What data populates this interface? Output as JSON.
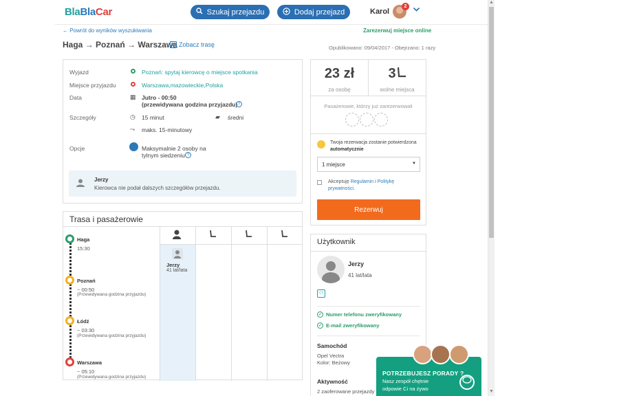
{
  "header": {
    "logo_bla1": "Bla",
    "logo_bla2": "Bla",
    "logo_car": "Car",
    "search_label": "Szukaj przejazdu",
    "add_label": "Dodaj przejazd",
    "user_name": "Karol",
    "notif_count": "2"
  },
  "nav": {
    "back_link": "← Powrót do wyników wyszukiwania",
    "reserve_online": "Zarezerwuj miejsce online"
  },
  "trip": {
    "title": "Haga → Poznań → Warszawa",
    "map_link": "Zobacz trasę",
    "published": "Opublikowano: 09/04/2017 - Obejrzano: 1 razy"
  },
  "details": {
    "departure_label": "Wyjazd",
    "departure_value": "Poznań: spytaj kierowcę o miejsce spotkania",
    "arrival_label": "Miejsce przyjazdu",
    "arrival_value": "Warszawa,mazowieckie,Polska",
    "date_label": "Data",
    "date_value": "Jutro - 00:50",
    "date_note": "(przewidywana godzina przyjazdu)",
    "details_label": "Szczegóły",
    "delay_value": "15 minut",
    "luggage_value": "średni",
    "detour_value": "maks. 15-minutowy",
    "options_label": "Opcje",
    "options_line1": "Maksymalnie 2 osoby na",
    "options_line2": "tylnym siedzeniu",
    "driver_name": "Jerzy",
    "driver_note": "Kierowca nie podał dalszych szczegółów przejazdu."
  },
  "route": {
    "title": "Trasa i pasażerowie",
    "stops": [
      {
        "name": "Haga",
        "time": "15:30",
        "note": ""
      },
      {
        "name": "Poznań",
        "time": "~ 00:50",
        "note": "(Przewidywana godzina przyjazdu)"
      },
      {
        "name": "Łódź",
        "time": "~ 03:30",
        "note": "(Przewidywana godzina przyjazdu)"
      },
      {
        "name": "Warszawa",
        "time": "~ 05:10",
        "note": "(Przewidywana godzina przyjazdu)"
      }
    ],
    "passenger_name": "Jerzy",
    "passenger_age": "41 lat/lata"
  },
  "booking": {
    "price": "23 zł",
    "price_label": "za osobę",
    "seats": "3",
    "seats_label": "wolne miejsca",
    "already_booked": "Pasażerowie, którzy już zarezerwowali",
    "auto_text": "Twoja rezerwacja zostanie potwierdzona",
    "auto_bold": "automatycznie",
    "seat_select": "1 miejsce",
    "accept_pre": "Akceptuję",
    "regulamin": "Regulamin",
    "and": "i",
    "policy": "Politykę prywatności",
    "reserve_button": "Rezerwuj"
  },
  "user": {
    "title": "Użytkownik",
    "name": "Jerzy",
    "age": "41 lat/lata",
    "phone_verified": "Numer telefonu zweryfikowany",
    "email_verified": "E-mail zweryfikowany",
    "car_heading": "Samochód",
    "car_model": "Opel Vectra",
    "car_color": "Kolor: Beżowy",
    "activity_heading": "Aktywność",
    "activity_text": "2 zaoferowane przejazdy"
  },
  "help": {
    "title": "POTRZEBUJESZ PORADY ?",
    "line1": "Nasz zespół chętnie",
    "line2": "odpowie Ci na żywo"
  },
  "colors": {
    "brand_blue": "#2b6fb3",
    "teal": "#1fa0a0",
    "green": "#2a9d6a",
    "orange": "#f26b1d",
    "red": "#e0403a"
  }
}
